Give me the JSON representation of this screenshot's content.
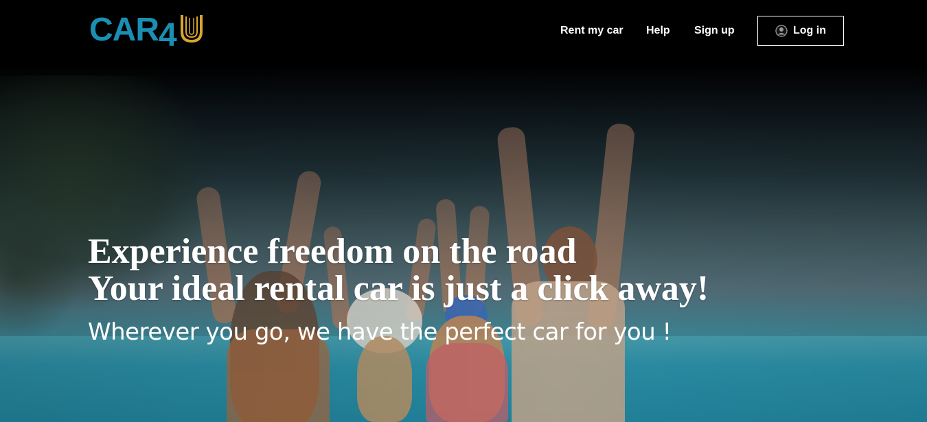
{
  "brand": {
    "logo_text": "CAR",
    "logo_number": "4",
    "logo_icon": "u-road-icon",
    "logo_alt": "CAR4U",
    "primary_color": "#1b8fb3",
    "accent_color": "#d7a630"
  },
  "nav": {
    "items": [
      {
        "label": "Rent my car"
      },
      {
        "label": "Help"
      },
      {
        "label": "Sign up"
      }
    ],
    "login": {
      "label": "Log in",
      "icon": "user-circle-icon"
    }
  },
  "hero": {
    "headline_line1": "Experience freedom on the road",
    "headline_line2": "Your ideal rental car is just a click away!",
    "subtitle": "Wherever you go, we have the perfect car for you !",
    "background": "family-at-beach-photo"
  }
}
